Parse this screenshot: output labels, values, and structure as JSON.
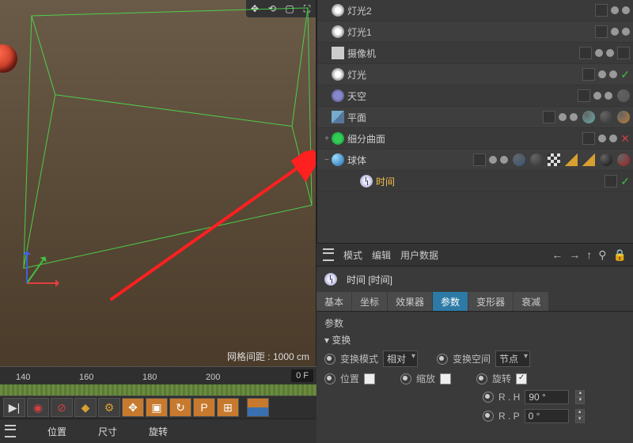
{
  "viewport": {
    "grid_label": "网格间距 : 1000 cm"
  },
  "ruler": {
    "ticks": [
      "140",
      "160",
      "180",
      "200"
    ],
    "frame": "0 F"
  },
  "footer": {
    "position": "位置",
    "size": "尺寸",
    "rotation": "旋转"
  },
  "tree": {
    "items": [
      {
        "icon": "light",
        "label": "灯光2",
        "checks": [
          "chk"
        ],
        "dots": [
          "gr",
          "gr"
        ]
      },
      {
        "icon": "light",
        "label": "灯光1",
        "checks": [
          "chk"
        ],
        "dots": [
          "gr",
          "gr"
        ]
      },
      {
        "icon": "cam",
        "label": "摄像机",
        "checks": [
          "chk"
        ],
        "dots": [
          "gr",
          "gr"
        ],
        "extra": "chk"
      },
      {
        "icon": "light",
        "label": "灯光",
        "checks": [
          "chk"
        ],
        "dots": [
          "gr",
          "gr"
        ],
        "mark": "check"
      },
      {
        "icon": "sky",
        "label": "天空",
        "checks": [
          "chk"
        ],
        "dots": [
          "gr",
          "gr"
        ],
        "tags": [
          {
            "t": "ball",
            "c": "#555"
          }
        ]
      },
      {
        "icon": "plane",
        "label": "平面",
        "checks": [
          "chk"
        ],
        "dots": [
          "gr",
          "gr"
        ],
        "tags": [
          {
            "t": "ball",
            "c": "#6aa"
          },
          {
            "t": "ball",
            "c": "#333"
          },
          {
            "t": "ball",
            "c": "#b97b3a"
          }
        ]
      },
      {
        "toggle": "+",
        "icon": "subdiv",
        "label": "细分曲面",
        "checks": [
          "chk"
        ],
        "dots": [
          "gr",
          "gr"
        ],
        "mark": "xmark"
      },
      {
        "toggle": "−",
        "icon": "sphere",
        "label": "球体",
        "checks": [
          "chk"
        ],
        "dots": [
          "gr",
          "gr"
        ],
        "tags": [
          {
            "t": "ball",
            "c": "#357"
          },
          {
            "t": "ball",
            "c": "#333"
          },
          {
            "t": "sq",
            "c": "checker"
          },
          {
            "t": "tri",
            "c": "#d8a030"
          },
          {
            "t": "tri",
            "c": "#d8a030"
          },
          {
            "t": "ball",
            "c": "#111"
          },
          {
            "t": "ball",
            "c": "#a02020"
          }
        ]
      },
      {
        "indent": 2,
        "icon": "time",
        "label": "时间",
        "selected": true,
        "checks": [
          "chk"
        ],
        "mark": "check"
      }
    ]
  },
  "attr_header": {
    "mode": "模式",
    "edit": "编辑",
    "userdata": "用户数据"
  },
  "attr_title": "时间 [时间]",
  "tabs": [
    "基本",
    "坐标",
    "效果器",
    "参数",
    "变形器",
    "衰减"
  ],
  "tab_active": 3,
  "params": {
    "heading": "参数",
    "subheading": "变换",
    "transform_mode_label": "变换模式",
    "transform_mode_value": "相对",
    "transform_space_label": "变换空间",
    "transform_space_value": "节点",
    "position_label": "位置",
    "scale_label": "缩放",
    "rotation_label": "旋转",
    "rh_label": "R . H",
    "rh_value": "90 °",
    "rp_label": "R . P",
    "rp_value": "0 °"
  }
}
